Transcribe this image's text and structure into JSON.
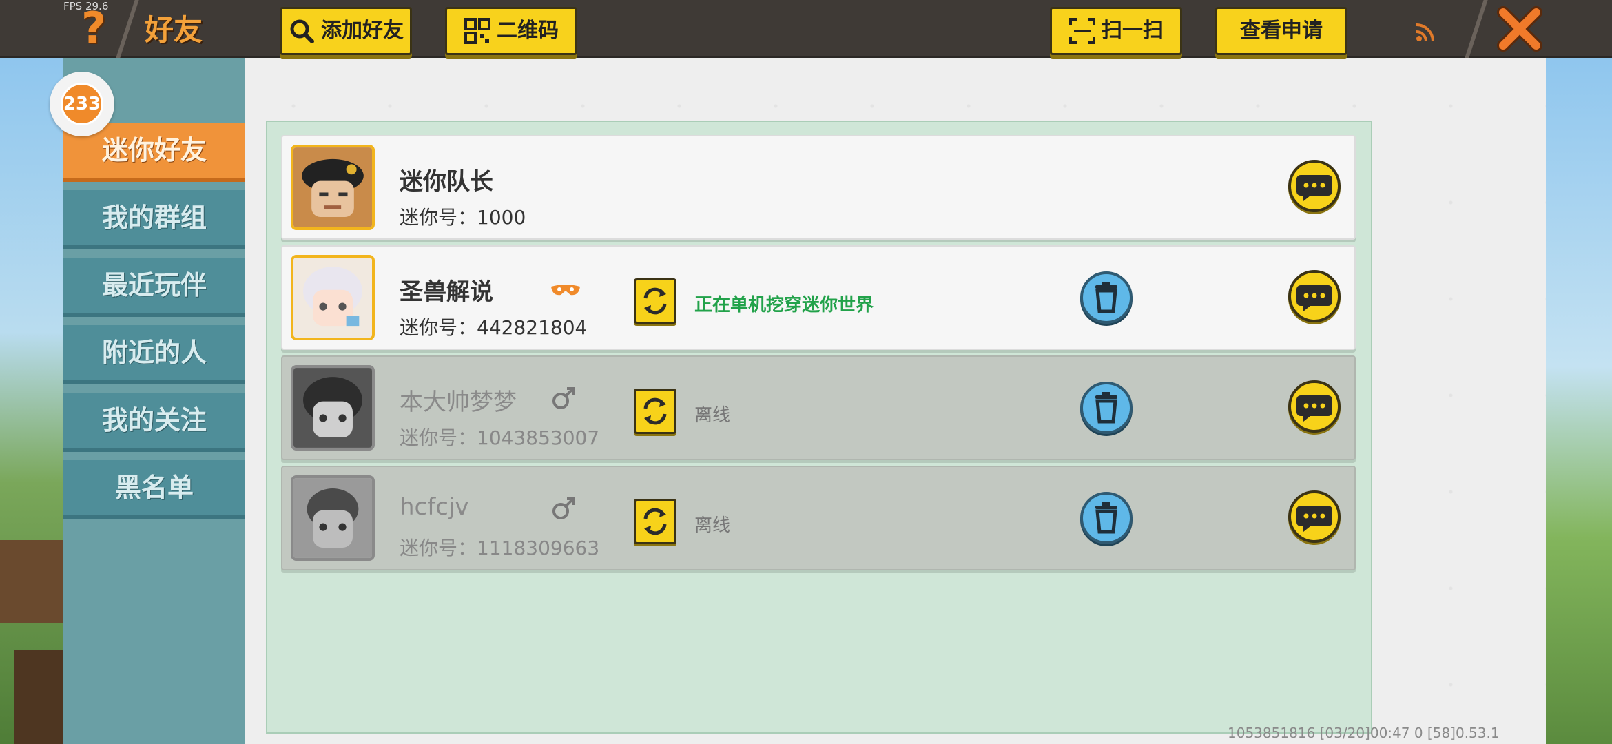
{
  "app": {
    "fps": "FPS 29.6",
    "title": "好友"
  },
  "toolbar": {
    "add_friend": "添加好友",
    "qr_code": "二维码",
    "scan": "扫一扫",
    "view_requests": "查看申请"
  },
  "badge": {
    "count": "233"
  },
  "sidebar": {
    "items": [
      {
        "label": "迷你好友",
        "active": true
      },
      {
        "label": "我的群组"
      },
      {
        "label": "最近玩伴"
      },
      {
        "label": "附近的人"
      },
      {
        "label": "我的关注"
      },
      {
        "label": "黑名单"
      }
    ]
  },
  "friends": [
    {
      "name": "迷你队长",
      "mini_id": "迷你号：1000",
      "online": true
    },
    {
      "name": "圣兽解说",
      "mini_id": "迷你号：442821804",
      "status": "正在单机挖穿迷你世界",
      "online": true
    },
    {
      "name": "本大帅梦梦",
      "mini_id": "迷你号：1043853007",
      "status": "离线",
      "online": false
    },
    {
      "name": "hcfcjv",
      "mini_id": "迷你号：1118309663",
      "status": "离线",
      "online": false
    }
  ],
  "footer": {
    "info": "1053851816   [03/20]00:47 0   [58]0.53.1"
  },
  "colors": {
    "accent": "#f0933a",
    "yellow": "#f7d21a",
    "online_status": "#22a24a"
  }
}
